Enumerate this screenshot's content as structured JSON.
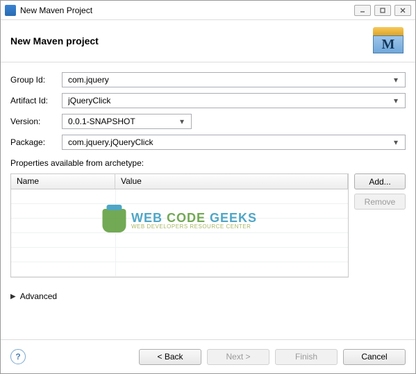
{
  "titlebar": {
    "title": "New Maven Project"
  },
  "header": {
    "title": "New Maven project"
  },
  "form": {
    "group_id": {
      "label": "Group Id:",
      "value": "com.jquery"
    },
    "artifact_id": {
      "label": "Artifact Id:",
      "value": "jQueryClick"
    },
    "version": {
      "label": "Version:",
      "value": "0.0.1-SNAPSHOT"
    },
    "package": {
      "label": "Package:",
      "value": "com.jquery.jQueryClick"
    }
  },
  "props": {
    "heading": "Properties available from archetype:",
    "columns": {
      "name": "Name",
      "value": "Value"
    },
    "buttons": {
      "add": "Add...",
      "remove": "Remove"
    }
  },
  "advanced": {
    "label": "Advanced"
  },
  "footer": {
    "back": "< Back",
    "next": "Next >",
    "finish": "Finish",
    "cancel": "Cancel"
  },
  "watermark": {
    "line1a": "WEB ",
    "line1b": "CODE",
    "line1c": " GEEKS",
    "line2": "WEB DEVELOPERS RESOURCE CENTER"
  }
}
